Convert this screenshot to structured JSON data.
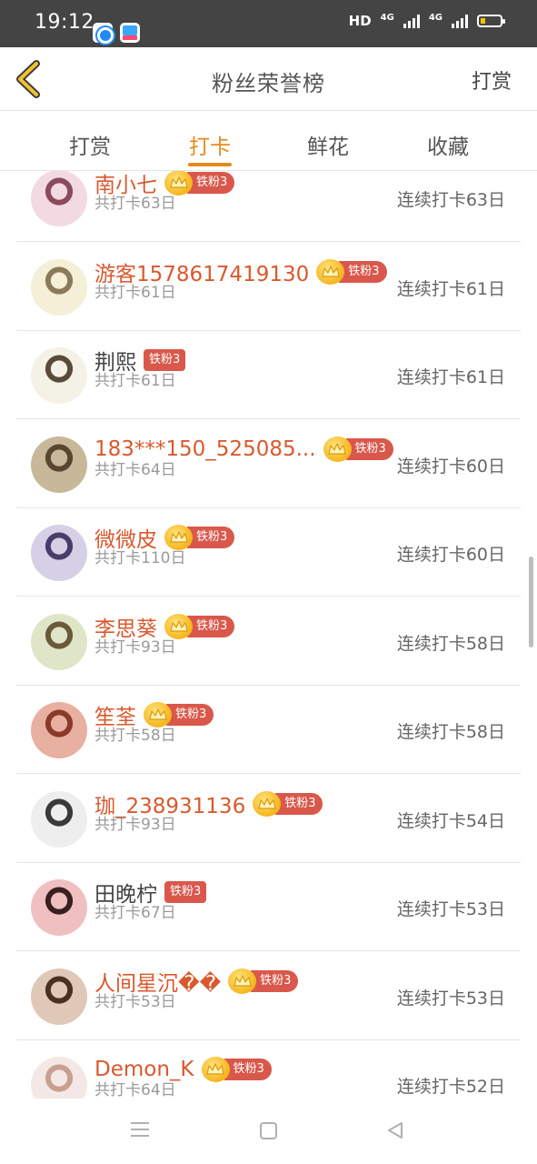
{
  "status_bar": {
    "time": "19:12",
    "network_1": "HD",
    "network_2": "4G",
    "network_3": "4G"
  },
  "header": {
    "back_icon": "chevron-left-icon",
    "title": "粉丝荣誉榜",
    "action_label": "打赏"
  },
  "tabs": [
    {
      "label": "打赏",
      "active": false
    },
    {
      "label": "打卡",
      "active": true
    },
    {
      "label": "鲜花",
      "active": false
    },
    {
      "label": "收藏",
      "active": false
    }
  ],
  "colors": {
    "accent": "#e48a1b",
    "name_highlight": "#d9592e",
    "badge": "#d9584b"
  },
  "fans": [
    {
      "name": "南小七",
      "crown": true,
      "badge": "铁粉3",
      "total": "共打卡63日",
      "streak": "连续打卡63日",
      "highlight": true
    },
    {
      "name": "游客1578617419130",
      "crown": true,
      "badge": "铁粉3",
      "total": "共打卡61日",
      "streak": "连续打卡61日",
      "highlight": true
    },
    {
      "name": "荆熙",
      "crown": false,
      "badge": "铁粉3",
      "total": "共打卡61日",
      "streak": "连续打卡61日",
      "highlight": false
    },
    {
      "name": "183***150_525085...",
      "crown": true,
      "badge": "铁粉3",
      "total": "共打卡64日",
      "streak": "连续打卡60日",
      "highlight": true
    },
    {
      "name": "微微皮",
      "crown": true,
      "badge": "铁粉3",
      "total": "共打卡110日",
      "streak": "连续打卡60日",
      "highlight": true
    },
    {
      "name": "李思葵",
      "crown": true,
      "badge": "铁粉3",
      "total": "共打卡93日",
      "streak": "连续打卡58日",
      "highlight": true
    },
    {
      "name": "笙荃",
      "crown": true,
      "badge": "铁粉3",
      "total": "共打卡58日",
      "streak": "连续打卡58日",
      "highlight": true
    },
    {
      "name": "珈_238931136",
      "crown": true,
      "badge": "铁粉3",
      "total": "共打卡93日",
      "streak": "连续打卡54日",
      "highlight": true
    },
    {
      "name": "田晚柠",
      "crown": false,
      "badge": "铁粉3",
      "total": "共打卡67日",
      "streak": "连续打卡53日",
      "highlight": false
    },
    {
      "name": "人间星沉��",
      "crown": true,
      "badge": "铁粉3",
      "total": "共打卡53日",
      "streak": "连续打卡53日",
      "highlight": true
    },
    {
      "name": "Demon_K",
      "crown": true,
      "badge": "铁粉3",
      "total": "共打卡64日",
      "streak": "连续打卡52日",
      "highlight": true
    }
  ],
  "nav_bar": {
    "menu_icon": "menu-icon",
    "home_icon": "home-icon",
    "back_icon": "back-triangle-icon"
  }
}
